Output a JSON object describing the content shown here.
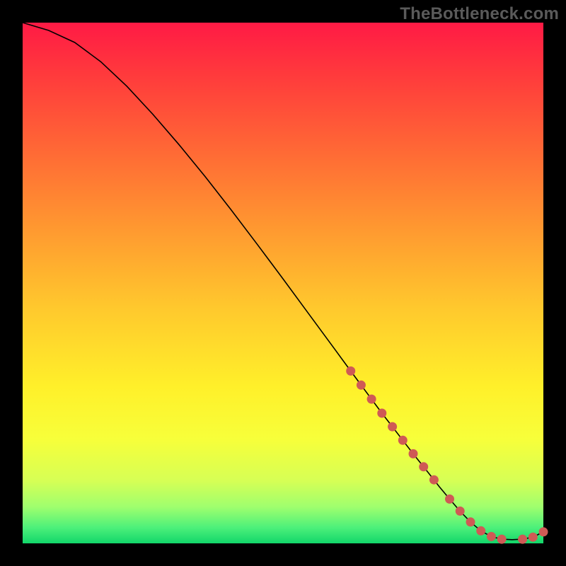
{
  "watermark": "TheBottleneck.com",
  "colors": {
    "background": "#000000",
    "curve": "#000000",
    "dots": "#cf5a55",
    "gradient_top": "#ff1a45",
    "gradient_bottom": "#12d66a"
  },
  "chart_data": {
    "type": "line",
    "title": "",
    "xlabel": "",
    "ylabel": "",
    "xlim": [
      0,
      100
    ],
    "ylim": [
      0,
      100
    ],
    "grid": false,
    "legend": false,
    "series": [
      {
        "name": "bottleneck-curve",
        "x": [
          0,
          5,
          10,
          15,
          20,
          25,
          30,
          35,
          40,
          45,
          50,
          55,
          60,
          63,
          65,
          67,
          69,
          71,
          73,
          75,
          77,
          79,
          80,
          82,
          84,
          86,
          88,
          90,
          92,
          94,
          96,
          98,
          100
        ],
        "y": [
          100,
          98.5,
          96.2,
          92.5,
          87.8,
          82.4,
          76.6,
          70.5,
          64.1,
          57.5,
          50.8,
          44.0,
          37.2,
          33.1,
          30.4,
          27.7,
          25.0,
          22.4,
          19.8,
          17.2,
          14.7,
          12.2,
          10.9,
          8.5,
          6.2,
          4.1,
          2.4,
          1.3,
          0.8,
          0.7,
          0.8,
          1.2,
          2.2
        ]
      }
    ],
    "highlighted_points": {
      "name": "dots",
      "x": [
        63,
        65,
        67,
        69,
        71,
        73,
        75,
        77,
        79,
        82,
        84,
        86,
        88,
        90,
        92,
        96,
        98,
        100
      ],
      "y": [
        33.1,
        30.4,
        27.7,
        25.0,
        22.4,
        19.8,
        17.2,
        14.7,
        12.2,
        8.5,
        6.2,
        4.1,
        2.4,
        1.3,
        0.8,
        0.8,
        1.2,
        2.2
      ]
    }
  }
}
